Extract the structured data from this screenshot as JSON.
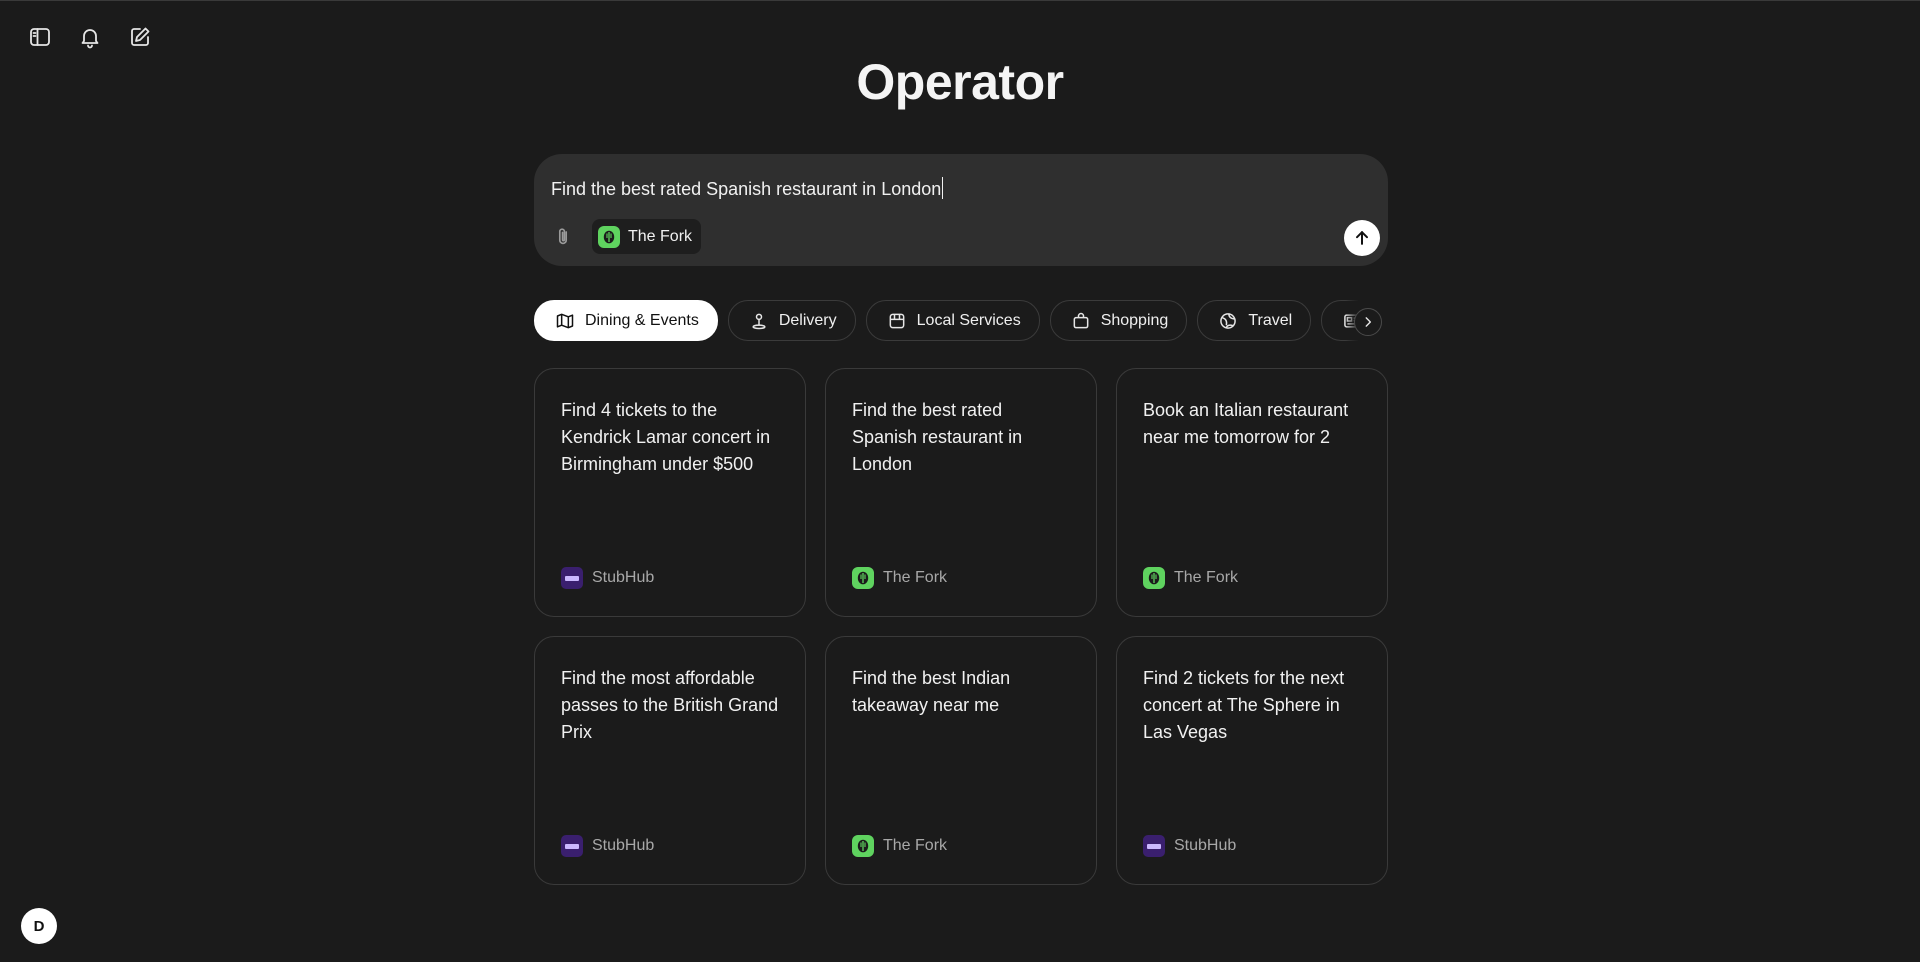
{
  "app": {
    "title": "Operator",
    "avatar_initial": "D"
  },
  "toolbar": {
    "icons": [
      "sidebar-toggle-icon",
      "bell-icon",
      "new-task-icon"
    ]
  },
  "composer": {
    "input_value": "Find the best rated Spanish restaurant in London",
    "selected_site": "The Fork",
    "icons": [
      "paperclip-icon",
      "arrow-up-icon"
    ]
  },
  "categories": [
    {
      "label": "Dining & Events",
      "icon": "map-icon",
      "active": true
    },
    {
      "label": "Delivery",
      "icon": "delivery-pin-icon",
      "active": false
    },
    {
      "label": "Local Services",
      "icon": "storefront-icon",
      "active": false
    },
    {
      "label": "Shopping",
      "icon": "shopping-bag-icon",
      "active": false
    },
    {
      "label": "Travel",
      "icon": "globe-icon",
      "active": false
    },
    {
      "label": "",
      "icon": "news-icon",
      "active": false
    }
  ],
  "cards": [
    {
      "text": "Find 4 tickets to the Kendrick Lamar concert in Birmingham under $500",
      "site": "StubHub",
      "logo": "stubhub"
    },
    {
      "text": "Find the best rated Spanish restaurant in London",
      "site": "The Fork",
      "logo": "thefork"
    },
    {
      "text": "Book an Italian restaurant near me tomorrow for 2",
      "site": "The Fork",
      "logo": "thefork"
    },
    {
      "text": "Find the most affordable passes to the British Grand Prix",
      "site": "StubHub",
      "logo": "stubhub"
    },
    {
      "text": "Find the best Indian takeaway near me",
      "site": "The Fork",
      "logo": "thefork"
    },
    {
      "text": "Find 2 tickets for the next concert at The Sphere in Las Vegas",
      "site": "StubHub",
      "logo": "stubhub"
    }
  ],
  "colors": {
    "background": "#1b1b1b",
    "composer": "#2f2f2f",
    "thefork_green": "#5fd35f",
    "stubhub_purple": "#3a1f6e"
  }
}
